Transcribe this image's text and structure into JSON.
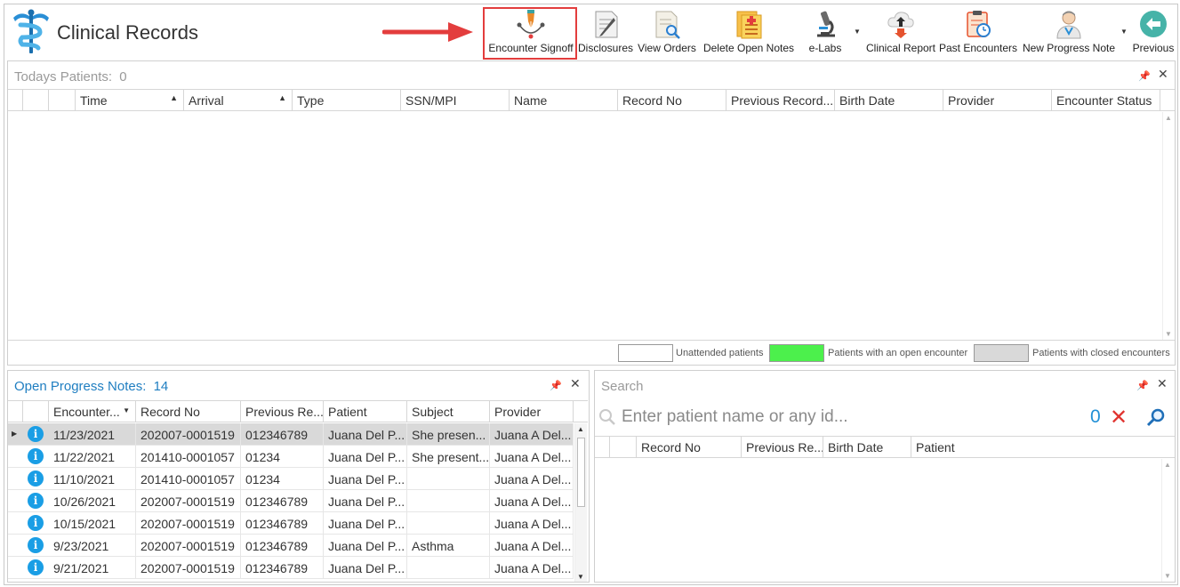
{
  "app": {
    "title": "Clinical Records"
  },
  "toolbar": {
    "items": [
      {
        "label": "Encounter Signoff",
        "icon": "pen-nib-icon"
      },
      {
        "label": "Disclosures",
        "icon": "document-edit-icon"
      },
      {
        "label": "View Orders",
        "icon": "document-search-icon"
      },
      {
        "label": "Delete Open Notes",
        "icon": "delete-notes-icon"
      },
      {
        "label": "e-Labs",
        "icon": "microscope-icon"
      },
      {
        "label": "Clinical Report",
        "icon": "cloud-report-icon"
      },
      {
        "label": "Past Encounters",
        "icon": "clipboard-history-icon"
      },
      {
        "label": "New Progress Note",
        "icon": "doctor-icon"
      },
      {
        "label": "Previous",
        "icon": "back-arrow-icon"
      }
    ]
  },
  "todays": {
    "title": "Todays Patients:",
    "count": "0",
    "columns": [
      "Time",
      "Arrival",
      "Type",
      "SSN/MPI",
      "Name",
      "Record No",
      "Previous Record...",
      "Birth Date",
      "Provider",
      "Encounter Status"
    ]
  },
  "legend": {
    "unattended": "Unattended patients",
    "open": "Patients with an open encounter",
    "closed": "Patients with closed encounters",
    "colors": {
      "unattended": "#ffffff",
      "open": "#4cf04c",
      "closed": "#d9d9d9"
    }
  },
  "notes": {
    "title": "Open Progress Notes:",
    "count": "14",
    "columns": [
      "Encounter...",
      "Record No",
      "Previous Re...",
      "Patient",
      "Subject",
      "Provider"
    ],
    "rows": [
      {
        "date": "11/23/2021",
        "record": "202007-0001519",
        "prev": "012346789",
        "patient": "Juana Del P...",
        "subject": " She presen...",
        "provider": "Juana A Del..."
      },
      {
        "date": "11/22/2021",
        "record": "201410-0001057",
        "prev": "01234",
        "patient": "Juana Del P...",
        "subject": "She present...",
        "provider": "Juana A Del..."
      },
      {
        "date": "11/10/2021",
        "record": "201410-0001057",
        "prev": "01234",
        "patient": "Juana Del P...",
        "subject": "",
        "provider": "Juana A Del..."
      },
      {
        "date": "10/26/2021",
        "record": "202007-0001519",
        "prev": "012346789",
        "patient": "Juana Del P...",
        "subject": "",
        "provider": "Juana A Del..."
      },
      {
        "date": "10/15/2021",
        "record": "202007-0001519",
        "prev": "012346789",
        "patient": "Juana Del P...",
        "subject": "",
        "provider": "Juana A Del..."
      },
      {
        "date": "9/23/2021",
        "record": "202007-0001519",
        "prev": "012346789",
        "patient": "Juana Del P...",
        "subject": "Asthma",
        "provider": "Juana A Del..."
      },
      {
        "date": "9/21/2021",
        "record": "202007-0001519",
        "prev": "012346789",
        "patient": "Juana Del P...",
        "subject": "",
        "provider": "Juana A Del..."
      }
    ]
  },
  "search": {
    "title": "Search",
    "placeholder": "Enter patient name or any id...",
    "count": "0",
    "columns": [
      "Record No",
      "Previous Re...",
      "Birth Date",
      "Patient"
    ]
  }
}
